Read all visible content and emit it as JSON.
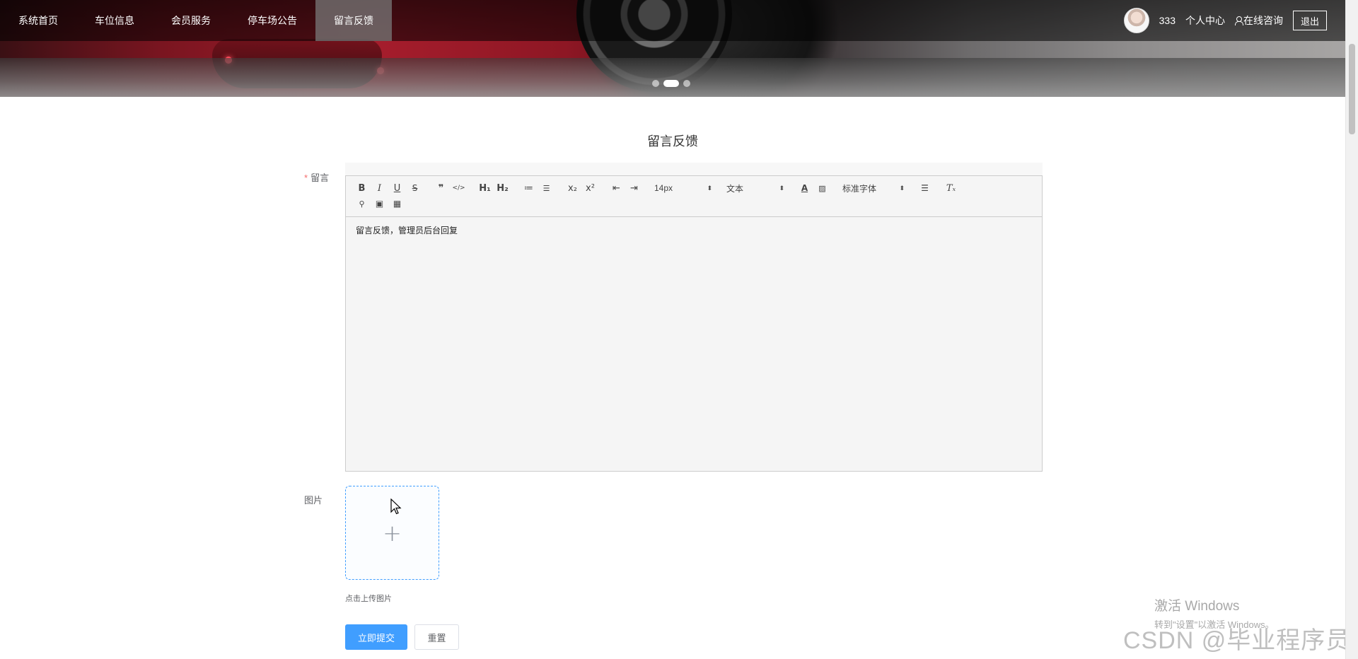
{
  "nav": {
    "items": [
      {
        "label": "系统首页"
      },
      {
        "label": "车位信息"
      },
      {
        "label": "会员服务"
      },
      {
        "label": "停车场公告"
      },
      {
        "label": "留言反馈",
        "active": true
      }
    ],
    "username": "333",
    "profile_label": "个人中心",
    "consult_label": "在线咨询",
    "logout_label": "退出"
  },
  "banner": {
    "slide_count": 3,
    "active_slide": 2
  },
  "page": {
    "title": "留言反馈"
  },
  "form": {
    "message_label": "留言",
    "message_required_mark": "*",
    "message_value": "留言反馈，管理员后台回复",
    "image_label": "图片",
    "upload_tip": "点击上传图片",
    "submit_label": "立即提交",
    "reset_label": "重置"
  },
  "editor": {
    "buttons_row1": [
      {
        "name": "bold-icon",
        "glyph": "B"
      },
      {
        "name": "italic-icon",
        "glyph": "I"
      },
      {
        "name": "underline-icon",
        "glyph": "U"
      },
      {
        "name": "strikethrough-icon",
        "glyph": "S"
      },
      {
        "name": "blockquote-icon",
        "glyph": "❞"
      },
      {
        "name": "code-block-icon",
        "glyph": "</>"
      },
      {
        "name": "heading-1-icon",
        "glyph": "H₁"
      },
      {
        "name": "heading-2-icon",
        "glyph": "H₂"
      },
      {
        "name": "ordered-list-icon",
        "glyph": "≔"
      },
      {
        "name": "bullet-list-icon",
        "glyph": "☰"
      },
      {
        "name": "subscript-icon",
        "glyph": "x₂"
      },
      {
        "name": "superscript-icon",
        "glyph": "x²"
      },
      {
        "name": "outdent-icon",
        "glyph": "⇤"
      },
      {
        "name": "indent-icon",
        "glyph": "⇥"
      }
    ],
    "size_select": "14px",
    "header_select": "文本",
    "font_select": "标准字体",
    "buttons_row2": [
      {
        "name": "link-icon",
        "glyph": "🔗"
      },
      {
        "name": "image-icon",
        "glyph": "🖼"
      },
      {
        "name": "video-icon",
        "glyph": "▦"
      }
    ]
  },
  "colors": {
    "primary": "#409eff",
    "nav_bg": "rgba(0,0,0,0.55)",
    "required": "#f56c6c"
  },
  "watermark": {
    "windows_line1": "激活 Windows",
    "windows_line2": "转到\"设置\"以激活 Windows。",
    "csdn": "CSDN @毕业程序员"
  }
}
